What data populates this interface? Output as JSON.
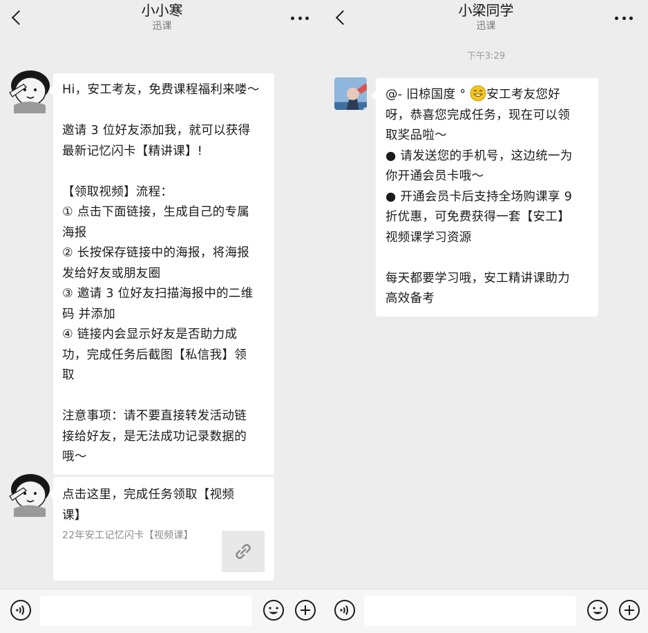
{
  "left_chat": {
    "header": {
      "title": "小小寒",
      "subtitle": "迅课"
    },
    "messages": [
      {
        "type": "text",
        "lines": [
          "Hi，安工考友，免费课程福利来喽～",
          "",
          "邀请 3 位好友添加我，就可以获得",
          "最新记忆闪卡【精讲课】!",
          "",
          "【领取视频】流程：",
          "① 点击下面链接，生成自己的专属",
          "海报",
          "② 长按保存链接中的海报，将海报",
          "发给好友或朋友圈",
          "③ 邀请 3 位好友扫描海报中的二维",
          "码 并添加",
          "④ 链接内会显示好友是否助力成",
          "功，完成任务后截图【私信我】领",
          "取",
          "",
          "注意事项：请不要直接转发活动链",
          "接给好友，是无法成功记录数据的",
          "哦～"
        ]
      },
      {
        "type": "link",
        "title_lines": [
          "点击这里，完成任务领取【视频",
          "课】"
        ],
        "desc": "22年安工记忆闪卡【视频课】"
      }
    ]
  },
  "right_chat": {
    "header": {
      "title": "小梁同学",
      "subtitle": "迅课"
    },
    "timestamp": "下午3:29",
    "messages": [
      {
        "type": "text",
        "first_line_a": "@- 旧椋国度 °",
        "first_line_b": "安工考友您好",
        "lines": [
          "呀，恭喜您完成任务，现在可以领",
          "取奖品啦～",
          "● 请发送您的手机号，这边统一为",
          "你开通会员卡哦～",
          "● 开通会员卡后支持全场购课享 9",
          "折优惠，可免费获得一套【安工】",
          "视频课学习资源",
          "",
          "每天都要学习哦，安工精讲课助力",
          "高效备考"
        ]
      }
    ]
  },
  "icons": [
    "back-icon",
    "more-icon",
    "voice-icon",
    "emoji-icon",
    "plus-icon",
    "link-icon"
  ],
  "colors": {
    "background": "#ededed",
    "bubble": "#ffffff",
    "text": "#1b1b1b",
    "muted": "#8a8a8a"
  }
}
